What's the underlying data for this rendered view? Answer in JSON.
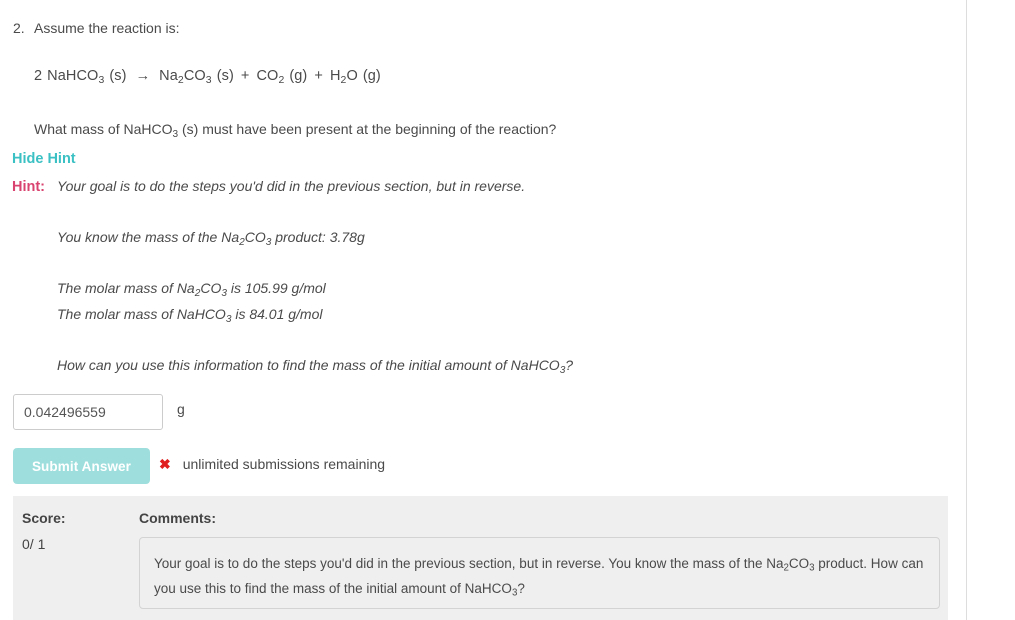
{
  "question": {
    "number": "2.",
    "prompt": "Assume the reaction is:",
    "equation": {
      "coefficient_reactant": "2",
      "reactant": "NaHCO",
      "reactant_sub": "3",
      "reactant_state": "(s)",
      "arrow": "→",
      "product1": "Na",
      "product1_sub1": "2",
      "product1_mid": "CO",
      "product1_sub2": "3",
      "product1_state": "(s)",
      "plus1": "+",
      "product2": "CO",
      "product2_sub": "2",
      "product2_state": "(g)",
      "plus2": "+",
      "product3": "H",
      "product3_sub": "2",
      "product3_mid": "O",
      "product3_state": "(g)",
      "full_text": "2 NaHCO3 (s) → Na2CO3 (s) + CO2 (g) + H2O (g)"
    },
    "followup_pre": "What mass of NaHCO",
    "followup_sub": "3",
    "followup_post": " (s) must have been present at the beginning of the reaction?"
  },
  "hint": {
    "toggle_label": "Hide Hint",
    "toggle_color": "#3bc0c3",
    "label": "Hint:",
    "label_color": "#d9436f",
    "first_line": "Your goal is to do the steps you'd did in the previous section, but in reverse.",
    "mass_pre": "You know the mass of the Na",
    "mass_sub1": "2",
    "mass_mid": "CO",
    "mass_sub2": "3",
    "mass_post": " product: 3.78g",
    "molar1_pre": "The molar mass of Na",
    "molar1_sub1": "2",
    "molar1_mid": "CO",
    "molar1_sub2": "3",
    "molar1_post": " is 105.99 g/mol",
    "molar2_pre": "The molar mass of NaHCO",
    "molar2_sub": "3",
    "molar2_post": " is 84.01 g/mol",
    "howto_pre": "How can you use this information to find the mass of the initial amount of NaHCO",
    "howto_sub": "3",
    "howto_post": "?"
  },
  "answer": {
    "value": "0.042496559",
    "placeholder": "",
    "unit": "g"
  },
  "submit": {
    "button_label": "Submit Answer",
    "button_color": "#9edfdd",
    "status_icon": "cross-icon",
    "status_icon_glyph": "✖",
    "status_icon_color": "#e02020",
    "status_text": "unlimited submissions remaining"
  },
  "grade": {
    "score_label": "Score:",
    "score_value": "0/ 1",
    "comments_label": "Comments:",
    "comment_pre": "Your goal is to do the steps you'd did in the previous section, but in reverse. You know the mass of the Na",
    "comment_sub1": "2",
    "comment_mid": "CO",
    "comment_sub2": "3",
    "comment_post_pre": " product. How can you use this to find the mass of the initial amount of NaHCO",
    "comment_sub3": "3",
    "comment_post": "?",
    "panel_color": "#efefef"
  }
}
